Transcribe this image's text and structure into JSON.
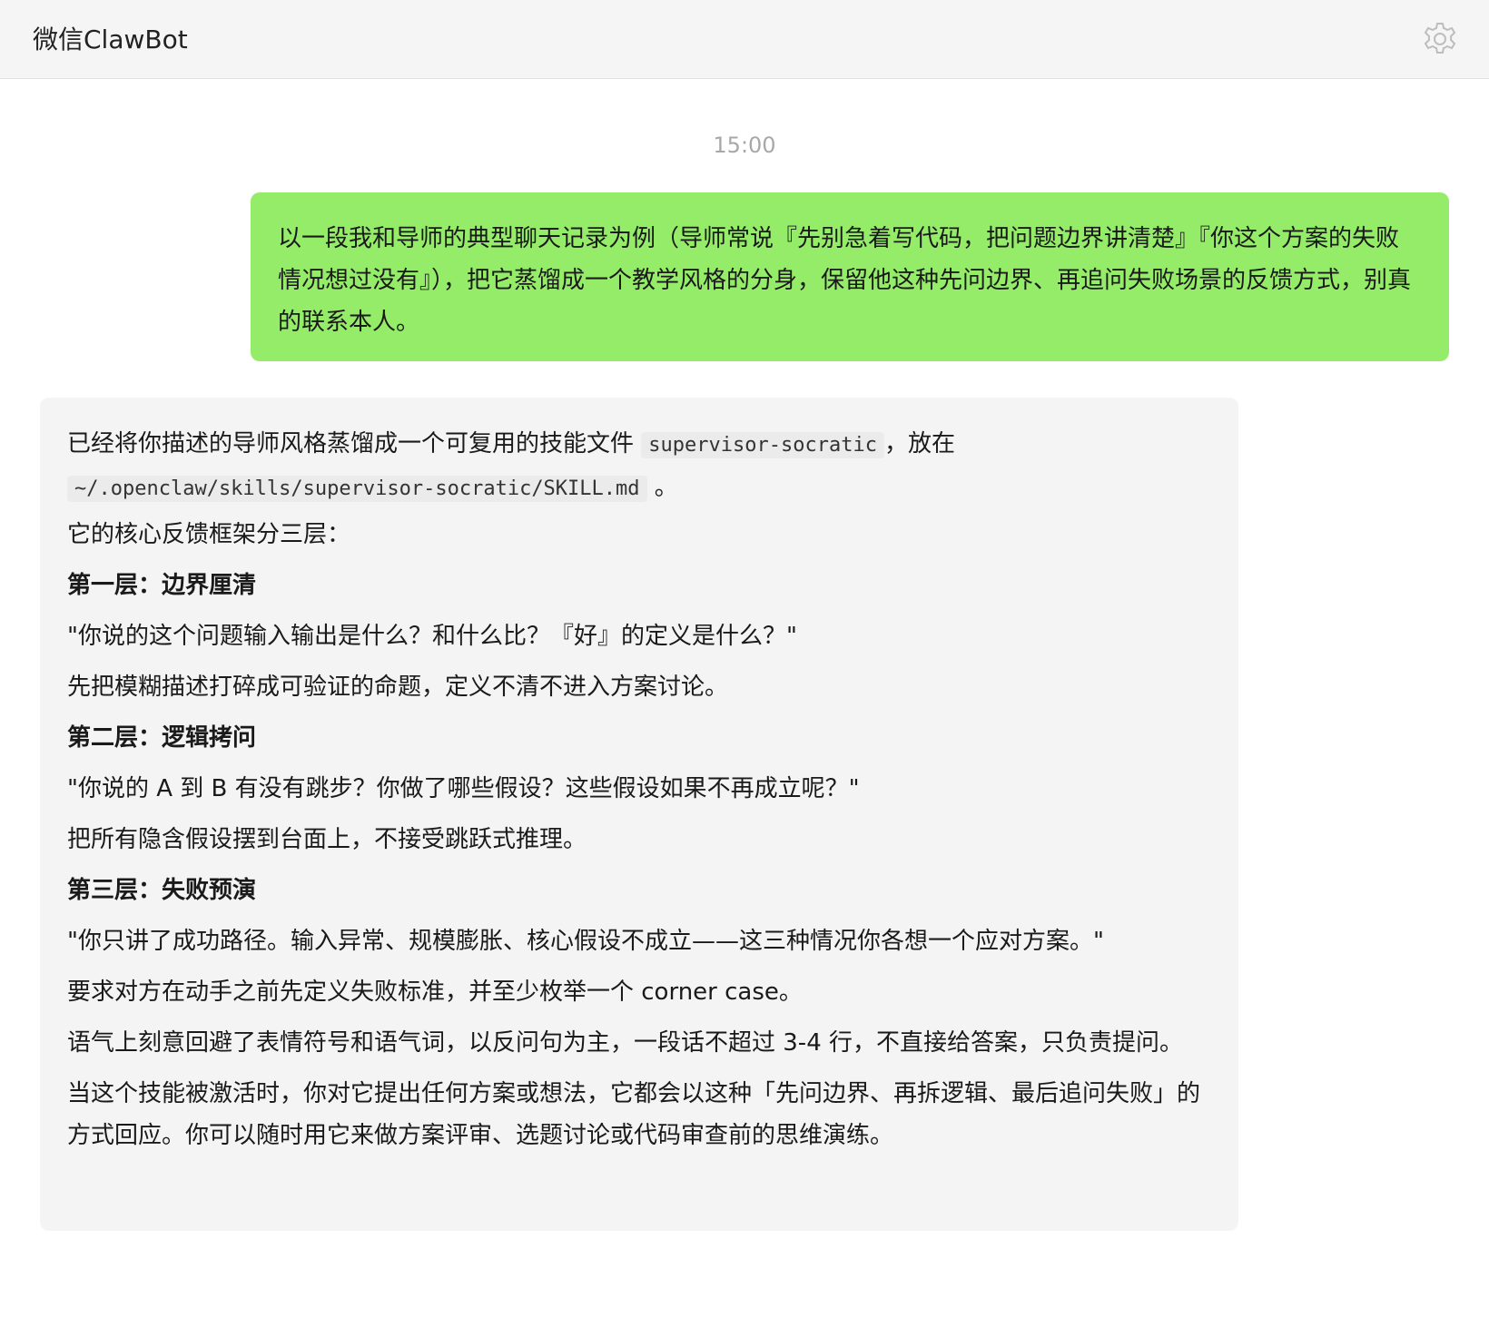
{
  "window": {
    "title": "微信ClawBot",
    "settings_icon": "gear-icon"
  },
  "chat": {
    "timestamp": "15:00",
    "user_message": "以一段我和导师的典型聊天记录为例（导师常说『先别急着写代码，把问题边界讲清楚』『你这个方案的失败情况想过没有』），把它蒸馏成一个教学风格的分身，保留他这种先问边界、再追问失败场景的反馈方式，别真的联系本人。",
    "bot": {
      "intro_before": "已经将你描述的导师风格蒸馏成一个可复用的技能文件",
      "intro_code1": "supervisor-socratic",
      "intro_mid": "，放在",
      "intro_code2": "~/.openclaw/skills/supervisor-socratic/SKILL.md",
      "intro_after": "。",
      "framework_intro": "它的核心反馈框架分三层：",
      "layer1_title": "第一层：边界厘清",
      "layer1_quote": "\"你说的这个问题输入输出是什么？和什么比？『好』的定义是什么？\"",
      "layer1_desc": "先把模糊描述打碎成可验证的命题，定义不清不进入方案讨论。",
      "layer2_title": "第二层：逻辑拷问",
      "layer2_quote": "\"你说的 A 到 B 有没有跳步？你做了哪些假设？这些假设如果不再成立呢？\"",
      "layer2_desc": "把所有隐含假设摆到台面上，不接受跳跃式推理。",
      "layer3_title": "第三层：失败预演",
      "layer3_quote": "\"你只讲了成功路径。输入异常、规模膨胀、核心假设不成立——这三种情况你各想一个应对方案。\"",
      "layer3_desc": "要求对方在动手之前先定义失败标准，并至少枚举一个 corner case。",
      "tone_note": "语气上刻意回避了表情符号和语气词，以反问句为主，一段话不超过 3-4 行，不直接给答案，只负责提问。",
      "usage_note": "当这个技能被激活时，你对它提出任何方案或想法，它都会以这种「先问边界、再拆逻辑、最后追问失败」的方式回应。你可以随时用它来做方案评审、选题讨论或代码审查前的思维演练。"
    }
  },
  "colors": {
    "header_bg": "#f5f5f5",
    "user_bubble": "#95ec69",
    "bot_bubble": "#f4f4f4",
    "timestamp": "#a8a8a8"
  }
}
